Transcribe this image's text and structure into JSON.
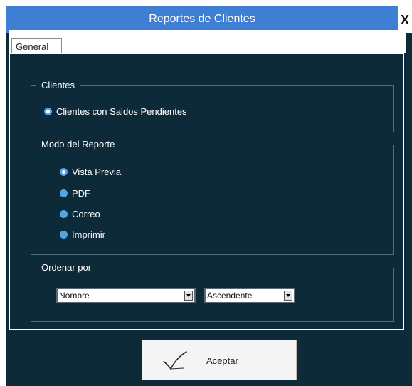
{
  "window": {
    "title": "Reportes de Clientes",
    "close_label": "X"
  },
  "tabs": [
    {
      "label": "General",
      "selected": true
    }
  ],
  "groups": {
    "clientes": {
      "legend": "Clientes",
      "options": [
        {
          "label": "Clientes con Saldos Pendientes",
          "checked": true
        }
      ]
    },
    "modo_reporte": {
      "legend": "Modo del  Reporte",
      "options": [
        {
          "label": "Vista Previa",
          "checked": true
        },
        {
          "label": "PDF",
          "checked": false
        },
        {
          "label": "Correo",
          "checked": false
        },
        {
          "label": "Imprimir",
          "checked": false
        }
      ]
    },
    "ordenar": {
      "legend": "Ordenar por",
      "field_value": "Nombre",
      "direction_value": "Ascendente"
    }
  },
  "buttons": {
    "aceptar_label": "Aceptar"
  },
  "colors": {
    "background": "#0d2a39",
    "titlebar": "#3f7fd3",
    "radio": "#4fa6e8"
  }
}
